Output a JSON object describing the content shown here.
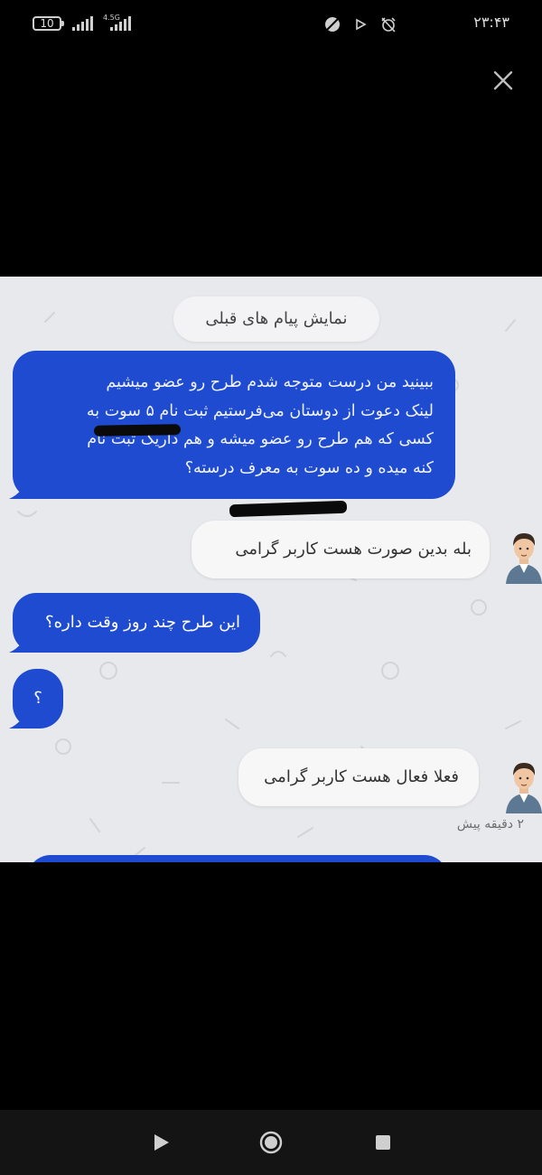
{
  "status_bar": {
    "battery_level": "10",
    "network_type": "4.5G",
    "clock": "۲۳:۴۳"
  },
  "chat": {
    "load_previous_label": "نمایش پیام های قبلی",
    "messages": [
      {
        "direction": "outgoing",
        "text": "ببینید من درست متوجه شدم طرح رو عضو میشیم\nلینک دعوت از دوستان می‌فرستیم ثبت نام ۵ سوت به\nکسی که هم طرح رو عضو میشه و هم داریک ثبت نام\nکنه میده و ده سوت به معرف درسته؟"
      },
      {
        "direction": "incoming",
        "text": "بله بدین صورت هست کاربر گرامی"
      },
      {
        "direction": "outgoing",
        "text": "این طرح چند روز وقت داره؟"
      },
      {
        "direction": "outgoing",
        "text": "؟"
      },
      {
        "direction": "incoming",
        "text": "فعلا فعال هست کاربر گرامی"
      }
    ],
    "last_timestamp": "۲ دقیقه پیش"
  },
  "colors": {
    "outgoing_bubble": "#1e4bcf",
    "incoming_bubble": "#f7f7f8",
    "chat_background": "#e8e9ec"
  },
  "icons": {
    "close": "close-icon",
    "nav_back": "nav-back-icon",
    "nav_home": "nav-home-icon",
    "nav_recents": "nav-recents-icon"
  }
}
